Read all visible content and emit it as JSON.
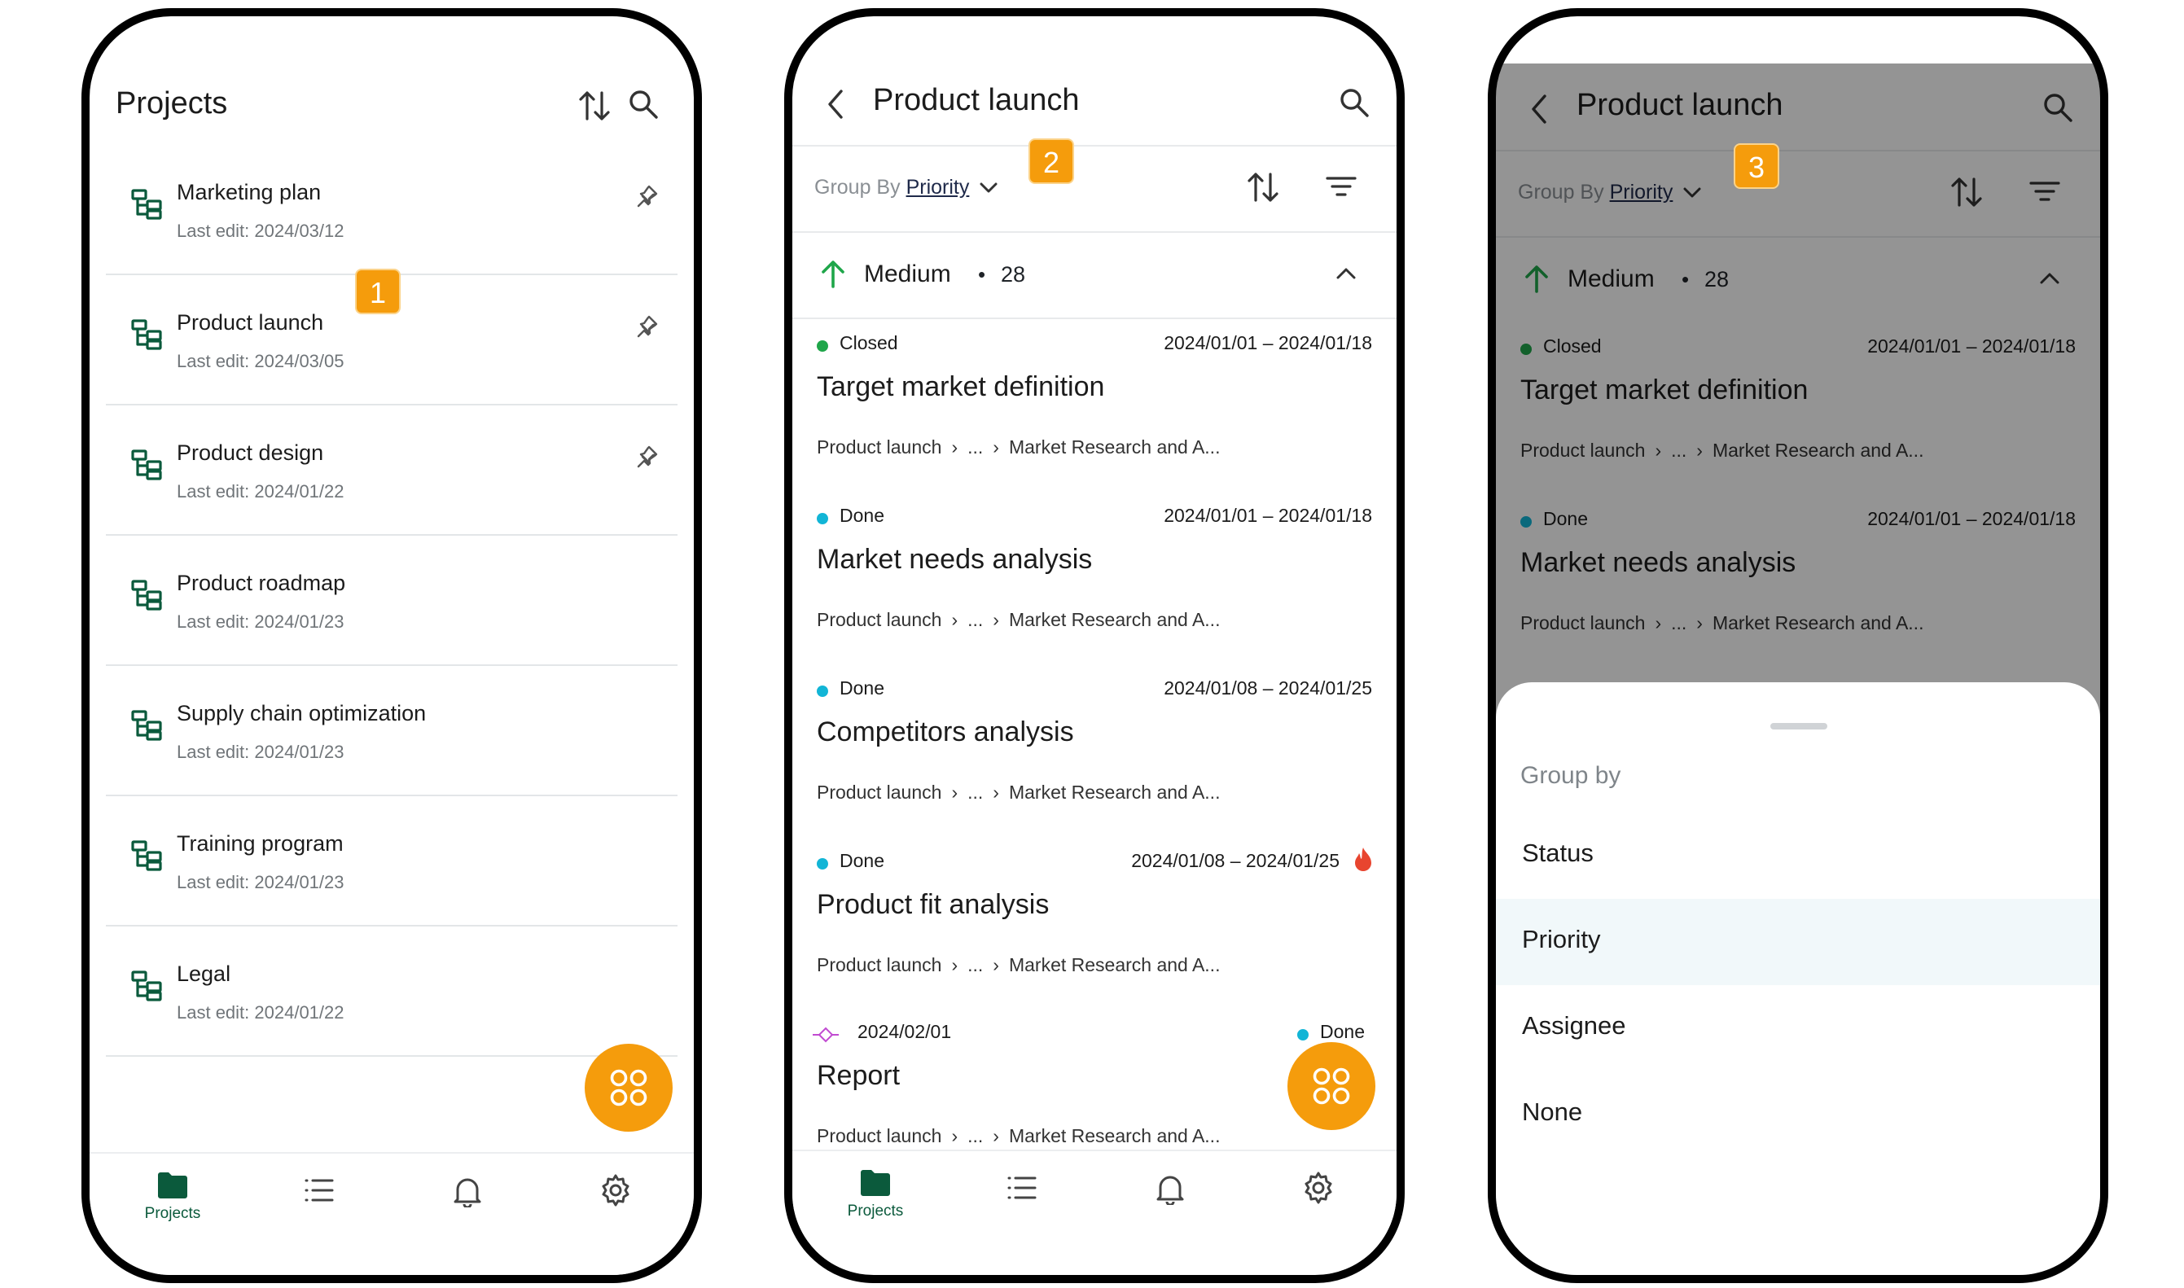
{
  "screen1": {
    "title": "Projects",
    "projects": [
      {
        "name": "Marketing plan",
        "last_edit": "Last edit: 2024/03/12",
        "pinned": true
      },
      {
        "name": "Product launch",
        "last_edit": "Last edit: 2024/03/05",
        "pinned": true
      },
      {
        "name": "Product design",
        "last_edit": "Last edit: 2024/01/22",
        "pinned": true
      },
      {
        "name": "Product roadmap",
        "last_edit": "Last edit: 2024/01/23",
        "pinned": false
      },
      {
        "name": "Supply chain optimization",
        "last_edit": "Last edit: 2024/01/23",
        "pinned": false
      },
      {
        "name": "Training program",
        "last_edit": "Last edit: 2024/01/23",
        "pinned": false
      },
      {
        "name": "Legal",
        "last_edit": "Last edit: 2024/01/22",
        "pinned": false
      }
    ],
    "badge": "1",
    "nav": {
      "projects_label": "Projects"
    }
  },
  "screen2": {
    "title": "Product launch",
    "group_by_label": "Group By",
    "group_by_value": "Priority",
    "badge": "2",
    "section": {
      "label": "Medium",
      "bullet": "•",
      "count": "28"
    },
    "tasks": [
      {
        "status": "Closed",
        "status_color": "#1fa64a",
        "dates": "2024/01/01 – 2024/01/18",
        "name": "Target market definition",
        "crumb1": "Product launch",
        "crumb2": "...",
        "crumb3": "Market Research and A..."
      },
      {
        "status": "Done",
        "status_color": "#12b5d6",
        "dates": "2024/01/01 – 2024/01/18",
        "name": "Market needs analysis",
        "crumb1": "Product launch",
        "crumb2": "...",
        "crumb3": "Market Research and A..."
      },
      {
        "status": "Done",
        "status_color": "#12b5d6",
        "dates": "2024/01/08 – 2024/01/25",
        "name": "Competitors analysis",
        "crumb1": "Product launch",
        "crumb2": "...",
        "crumb3": "Market Research and A..."
      },
      {
        "status": "Done",
        "status_color": "#12b5d6",
        "dates": "2024/01/08 – 2024/01/25",
        "name": "Product fit analysis",
        "crumb1": "Product launch",
        "crumb2": "...",
        "crumb3": "Market Research and A...",
        "urgent": true
      }
    ],
    "milestone": {
      "date": "2024/02/01",
      "status": "Done",
      "name": "Report",
      "crumb1": "Product launch",
      "crumb2": "...",
      "crumb3": "Market Research and A..."
    },
    "nav": {
      "projects_label": "Projects"
    }
  },
  "screen3": {
    "title": "Product launch",
    "group_by_label": "Group By",
    "group_by_value": "Priority",
    "badge": "3",
    "section": {
      "label": "Medium",
      "bullet": "•",
      "count": "28"
    },
    "tasks": [
      {
        "status": "Closed",
        "dates": "2024/01/01 – 2024/01/18",
        "name": "Target market definition",
        "crumb1": "Product launch",
        "crumb2": "...",
        "crumb3": "Market Research and A..."
      },
      {
        "status": "Done",
        "dates": "2024/01/01 – 2024/01/18",
        "name": "Market needs analysis",
        "crumb1": "Product launch",
        "crumb2": "...",
        "crumb3": "Market Research and A..."
      }
    ],
    "sheet": {
      "title": "Group by",
      "options": [
        "Status",
        "Priority",
        "Assignee",
        "None"
      ],
      "selected": "Priority"
    }
  },
  "colors": {
    "accent": "#f59c0c",
    "brand_green": "#0b5a3c",
    "closed": "#1fa64a",
    "done": "#12b5d6",
    "urgent": "#e8452f",
    "milestone": "#c14ad1"
  }
}
